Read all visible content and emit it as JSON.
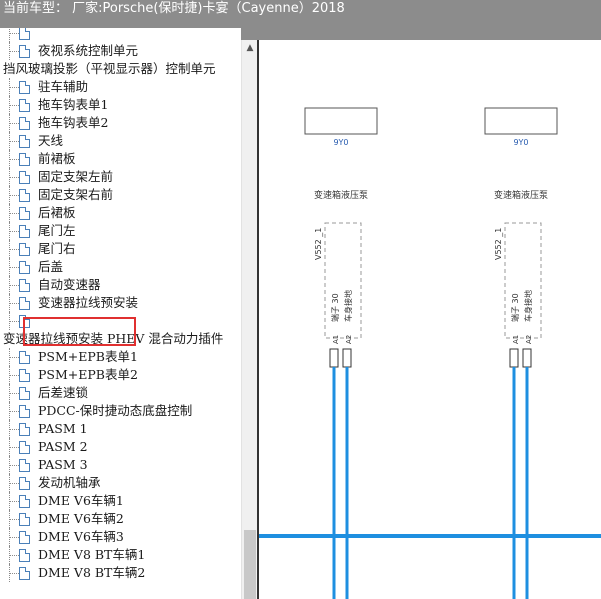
{
  "window": {
    "title": "当前车型：  厂家:Porsche(保时捷)卡宴（Cayenne）2018"
  },
  "tree": {
    "rows": [
      {
        "label": "",
        "kind": "item"
      },
      {
        "label": "夜视系统控制单元",
        "kind": "item"
      },
      {
        "label": "挡风玻璃投影（平视显示器）控制单元",
        "kind": "category"
      },
      {
        "label": "驻车辅助",
        "kind": "item"
      },
      {
        "label": "拖车钩表单1",
        "kind": "item"
      },
      {
        "label": "拖车钩表单2",
        "kind": "item"
      },
      {
        "label": "天线",
        "kind": "item"
      },
      {
        "label": "前裙板",
        "kind": "item"
      },
      {
        "label": "固定支架左前",
        "kind": "item"
      },
      {
        "label": "固定支架右前",
        "kind": "item"
      },
      {
        "label": "后裙板",
        "kind": "item"
      },
      {
        "label": "尾门左",
        "kind": "item"
      },
      {
        "label": "尾门右",
        "kind": "item"
      },
      {
        "label": "后盖",
        "kind": "item"
      },
      {
        "label": "自动变速器",
        "kind": "item",
        "selected": true
      },
      {
        "label": "变速器拉线预安装",
        "kind": "item"
      },
      {
        "label": "",
        "kind": "item"
      },
      {
        "label": "变速器拉线预安装 PHEV 混合动力插件",
        "kind": "category"
      },
      {
        "label": "PSM+EPB表单1",
        "kind": "item"
      },
      {
        "label": "PSM+EPB表单2",
        "kind": "item"
      },
      {
        "label": "后差速锁",
        "kind": "item"
      },
      {
        "label": "PDCC-保时捷动态底盘控制",
        "kind": "item"
      },
      {
        "label": "PASM 1",
        "kind": "item"
      },
      {
        "label": "PASM 2",
        "kind": "item"
      },
      {
        "label": "PASM 3",
        "kind": "item"
      },
      {
        "label": "发动机轴承",
        "kind": "item"
      },
      {
        "label": "DME V6车辆1",
        "kind": "item"
      },
      {
        "label": "DME V6车辆2",
        "kind": "item"
      },
      {
        "label": "DME V6车辆3",
        "kind": "item"
      },
      {
        "label": "DME V8 BT车辆1",
        "kind": "item"
      },
      {
        "label": "DME V8 BT车辆2",
        "kind": "item"
      }
    ]
  },
  "scrollbar": {
    "up_arrow": "▲"
  },
  "diagram": {
    "accent": "#1e8fe0",
    "components": [
      {
        "box_label": "9Y0",
        "title": "变速箱液压泵",
        "ref": "V552 _1",
        "terminal_1": "端子 30",
        "terminal_2": "车身接地",
        "pin_1": "A1",
        "pin_2": "A2"
      },
      {
        "box_label": "9Y0",
        "title": "变速箱液压泵",
        "ref": "V552 _1",
        "terminal_1": "端子 30",
        "terminal_2": "车身接地",
        "pin_1": "A1",
        "pin_2": "A2"
      }
    ]
  }
}
